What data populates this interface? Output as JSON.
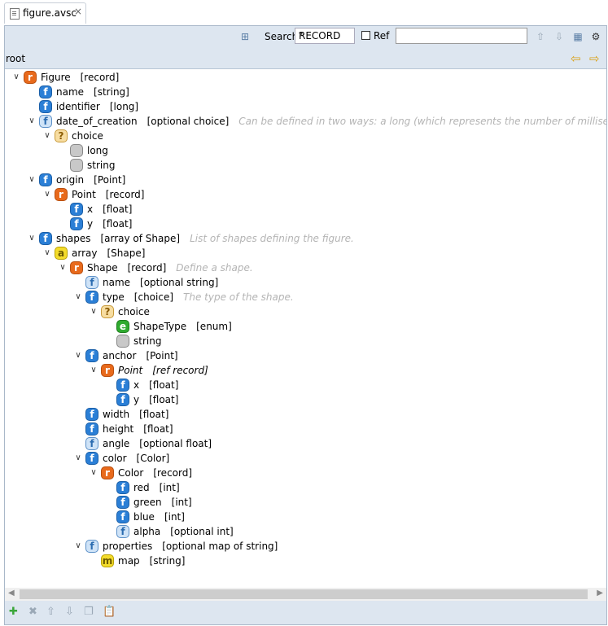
{
  "tab": {
    "title": "figure.avsc",
    "close_glyph": "×"
  },
  "toolbar": {
    "search_label": "Search:",
    "search_mode": "RECORD",
    "ref_label": "Ref",
    "search_value": ""
  },
  "rootbar": {
    "label": "root"
  },
  "tree": [
    {
      "level": 0,
      "exp": "open",
      "badge": "r",
      "name": "Figure",
      "type": "[record]",
      "doc": ""
    },
    {
      "level": 1,
      "exp": "none",
      "badge": "f",
      "name": "name",
      "type": "[string]",
      "doc": ""
    },
    {
      "level": 1,
      "exp": "none",
      "badge": "f",
      "name": "identifier",
      "type": "[long]",
      "doc": ""
    },
    {
      "level": 1,
      "exp": "open",
      "badge": "fo",
      "name": "date_of_creation",
      "type": "[optional choice]",
      "doc": "Can be defined in two ways: a long (which represents the number of milliseconds since Janu"
    },
    {
      "level": 2,
      "exp": "open",
      "badge": "q",
      "name": "choice",
      "type": "",
      "doc": ""
    },
    {
      "level": 3,
      "exp": "none",
      "badge": "g",
      "name": "long",
      "type": "",
      "doc": ""
    },
    {
      "level": 3,
      "exp": "none",
      "badge": "g",
      "name": "string",
      "type": "",
      "doc": ""
    },
    {
      "level": 1,
      "exp": "open",
      "badge": "f",
      "name": "origin",
      "type": "[Point]",
      "doc": ""
    },
    {
      "level": 2,
      "exp": "open",
      "badge": "r",
      "name": "Point",
      "type": "[record]",
      "doc": ""
    },
    {
      "level": 3,
      "exp": "none",
      "badge": "f",
      "name": "x",
      "type": "[float]",
      "doc": ""
    },
    {
      "level": 3,
      "exp": "none",
      "badge": "f",
      "name": "y",
      "type": "[float]",
      "doc": ""
    },
    {
      "level": 1,
      "exp": "open",
      "badge": "f",
      "name": "shapes",
      "type": "[array of Shape]",
      "doc": "List of shapes defining the figure."
    },
    {
      "level": 2,
      "exp": "open",
      "badge": "a",
      "name": "array",
      "type": "[Shape]",
      "doc": ""
    },
    {
      "level": 3,
      "exp": "open",
      "badge": "r",
      "name": "Shape",
      "type": "[record]",
      "doc": "Define a shape."
    },
    {
      "level": 4,
      "exp": "none",
      "badge": "fo",
      "name": "name",
      "type": "[optional string]",
      "doc": ""
    },
    {
      "level": 4,
      "exp": "open",
      "badge": "f",
      "name": "type",
      "type": "[choice]",
      "doc": "The type of the shape."
    },
    {
      "level": 5,
      "exp": "open",
      "badge": "q",
      "name": "choice",
      "type": "",
      "doc": ""
    },
    {
      "level": 6,
      "exp": "none",
      "badge": "e",
      "name": "ShapeType",
      "type": "[enum]",
      "doc": ""
    },
    {
      "level": 6,
      "exp": "none",
      "badge": "g",
      "name": "string",
      "type": "",
      "doc": ""
    },
    {
      "level": 4,
      "exp": "open",
      "badge": "f",
      "name": "anchor",
      "type": "[Point]",
      "doc": ""
    },
    {
      "level": 5,
      "exp": "open",
      "badge": "r",
      "name": "Point",
      "type": "[ref record]",
      "doc": "",
      "italic": true
    },
    {
      "level": 6,
      "exp": "none",
      "badge": "f",
      "name": "x",
      "type": "[float]",
      "doc": ""
    },
    {
      "level": 6,
      "exp": "none",
      "badge": "f",
      "name": "y",
      "type": "[float]",
      "doc": ""
    },
    {
      "level": 4,
      "exp": "none",
      "badge": "f",
      "name": "width",
      "type": "[float]",
      "doc": ""
    },
    {
      "level": 4,
      "exp": "none",
      "badge": "f",
      "name": "height",
      "type": "[float]",
      "doc": ""
    },
    {
      "level": 4,
      "exp": "none",
      "badge": "fo",
      "name": "angle",
      "type": "[optional float]",
      "doc": ""
    },
    {
      "level": 4,
      "exp": "open",
      "badge": "f",
      "name": "color",
      "type": "[Color]",
      "doc": ""
    },
    {
      "level": 5,
      "exp": "open",
      "badge": "r",
      "name": "Color",
      "type": "[record]",
      "doc": ""
    },
    {
      "level": 6,
      "exp": "none",
      "badge": "f",
      "name": "red",
      "type": "[int]",
      "doc": ""
    },
    {
      "level": 6,
      "exp": "none",
      "badge": "f",
      "name": "green",
      "type": "[int]",
      "doc": ""
    },
    {
      "level": 6,
      "exp": "none",
      "badge": "f",
      "name": "blue",
      "type": "[int]",
      "doc": ""
    },
    {
      "level": 6,
      "exp": "none",
      "badge": "fo",
      "name": "alpha",
      "type": "[optional int]",
      "doc": ""
    },
    {
      "level": 4,
      "exp": "open",
      "badge": "fo",
      "name": "properties",
      "type": "[optional map of string]",
      "doc": ""
    },
    {
      "level": 5,
      "exp": "none",
      "badge": "m",
      "name": "map",
      "type": "[string]",
      "doc": ""
    }
  ],
  "badge_letters": {
    "f": "f",
    "fo": "f",
    "r": "r",
    "q": "?",
    "g": "",
    "a": "a",
    "e": "e",
    "m": "m"
  }
}
